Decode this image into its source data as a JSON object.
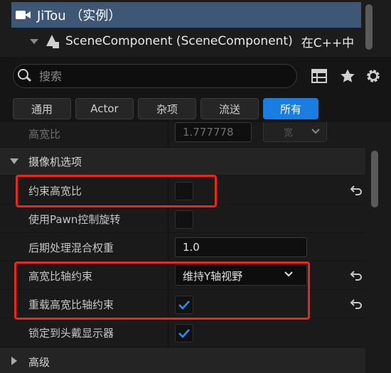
{
  "tree": {
    "title": "JiTou （实例）",
    "component": "SceneComponent (SceneComponent)",
    "component_extra": "在C++中"
  },
  "search": {
    "placeholder": "搜索"
  },
  "tabs": [
    {
      "label": "通用"
    },
    {
      "label": "Actor"
    },
    {
      "label": "杂项"
    },
    {
      "label": "流送"
    },
    {
      "label": "所有"
    }
  ],
  "properties": {
    "aspect_ratio": {
      "label": "高宽比",
      "value": "1.777778",
      "extra": "宽"
    },
    "camera_section": {
      "label": "摄像机选项"
    },
    "constrain_aspect": {
      "label": "约束高宽比"
    },
    "use_pawn_rotation": {
      "label": "使用Pawn控制旋转"
    },
    "postprocess_weight": {
      "label": "后期处理混合权重",
      "value": "1.0"
    },
    "aspect_axis_constraint": {
      "label": "高宽比轴约束",
      "value": "维持Y轴视野"
    },
    "override_aspect_axis": {
      "label": "重载高宽比轴约束"
    },
    "lock_to_hmd": {
      "label": "锁定到头戴显示器"
    },
    "advanced_section": {
      "label": "高级"
    }
  },
  "colors": {
    "accent": "#1a7ee0",
    "highlight": "#e8271d",
    "selection": "#3d5775"
  }
}
